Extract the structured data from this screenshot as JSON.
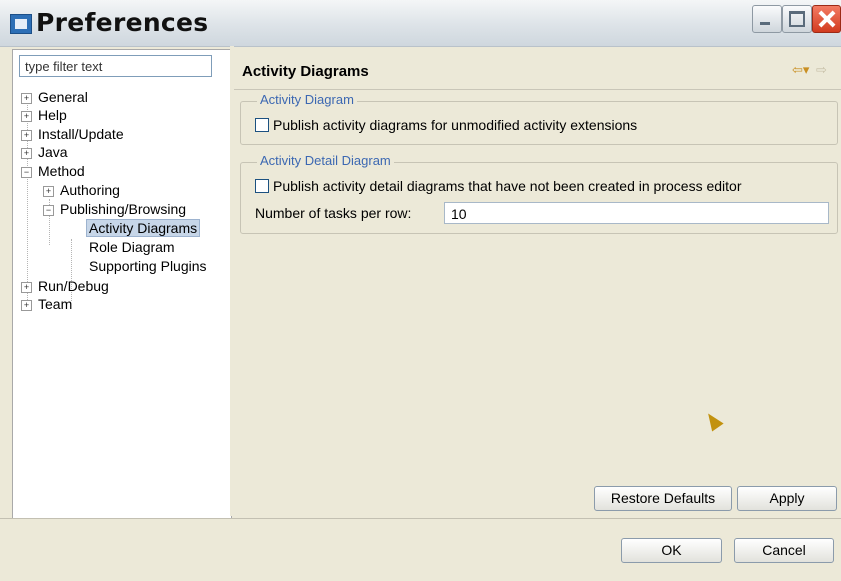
{
  "window": {
    "title": "Preferences",
    "controls": {
      "minimize": "minimize-button",
      "maximize": "maximize-button",
      "close": "close-button"
    }
  },
  "sidebar": {
    "filter_value": "type filter text",
    "tree": [
      {
        "label": "General",
        "expander": "+",
        "depth": 0
      },
      {
        "label": "Help",
        "expander": "+",
        "depth": 0
      },
      {
        "label": "Install/Update",
        "expander": "+",
        "depth": 0
      },
      {
        "label": "Java",
        "expander": "+",
        "depth": 0
      },
      {
        "label": "Method",
        "expander": "−",
        "depth": 0
      },
      {
        "label": "Authoring",
        "expander": "+",
        "depth": 1
      },
      {
        "label": "Publishing/Browsing",
        "expander": "−",
        "depth": 1
      },
      {
        "label": "Activity Diagrams",
        "expander": "",
        "depth": 2,
        "selected": true
      },
      {
        "label": "Role Diagram",
        "expander": "",
        "depth": 2
      },
      {
        "label": "Supporting Plugins",
        "expander": "",
        "depth": 2
      },
      {
        "label": "Run/Debug",
        "expander": "+",
        "depth": 0
      },
      {
        "label": "Team",
        "expander": "+",
        "depth": 0
      }
    ]
  },
  "page": {
    "title": "Activity Diagrams",
    "icons": {
      "back": "back-arrow-icon",
      "forward": "forward-arrow-icon"
    },
    "groups": [
      {
        "title": "Activity Diagram",
        "checkbox_label": "Publish activity diagrams for unmodified activity extensions",
        "checked": false
      },
      {
        "title": "Activity Detail Diagram",
        "checkbox_label": "Publish activity detail diagrams that have not been created in process editor",
        "checked": false,
        "field_label": "Number of tasks per row:",
        "field_value": "10"
      }
    ],
    "restore_defaults_label": "Restore Defaults",
    "apply_label": "Apply"
  },
  "footer": {
    "ok_label": "OK",
    "cancel_label": "Cancel"
  },
  "colors": {
    "background": "#ece9d8",
    "group_title": "#3c68b2",
    "selection": "#c7d6e8",
    "close_button": "#d23b1f"
  }
}
